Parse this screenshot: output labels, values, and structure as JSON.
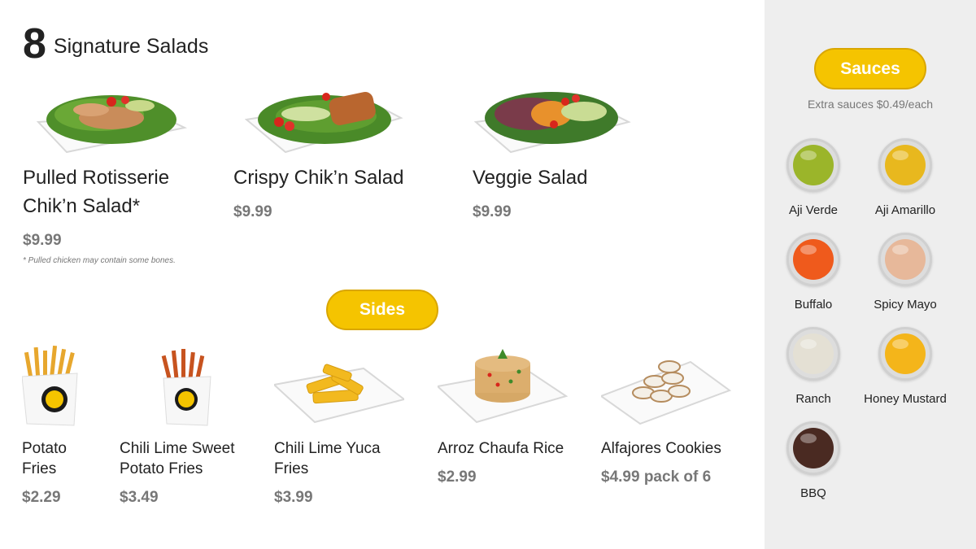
{
  "salads_section": {
    "number": "8",
    "title": "Signature Salads",
    "items": [
      {
        "name_line1": "Pulled Rotisserie",
        "name_line2": "Chik’n Salad*",
        "price": "$9.99",
        "footnote": "* Pulled chicken may contain some bones."
      },
      {
        "name_line1": "Crispy Chik’n Salad",
        "price": "$9.99"
      },
      {
        "name_line1": "Veggie Salad",
        "price": "$9.99"
      }
    ]
  },
  "sides_section": {
    "title": "Sides",
    "items": [
      {
        "name_line1": "Potato",
        "name_line2": "Fries",
        "price": "$2.29"
      },
      {
        "name_line1": "Chili Lime Sweet",
        "name_line2": "Potato Fries",
        "price": "$3.49"
      },
      {
        "name_line1": "Chili Lime Yuca",
        "name_line2": "Fries",
        "price": "$3.99"
      },
      {
        "name_line1": "Arroz Chaufa Rice",
        "price": "$2.99"
      },
      {
        "name_line1": "Alfajores Cookies",
        "price": "$4.99 pack of 6"
      }
    ]
  },
  "sauces_section": {
    "title": "Sauces",
    "note": "Extra sauces $0.49/each",
    "items": [
      {
        "name": "Aji Verde",
        "color": "#9bb52a"
      },
      {
        "name": "Aji Amarillo",
        "color": "#e8b81e"
      },
      {
        "name": "Buffalo",
        "color": "#ef5a1c"
      },
      {
        "name": "Spicy Mayo",
        "color": "#e7b89a"
      },
      {
        "name": "Ranch",
        "color": "#e4e0d4"
      },
      {
        "name": "Honey Mustard",
        "color": "#f4b51a"
      },
      {
        "name": "BBQ",
        "color": "#4a2a22"
      }
    ]
  },
  "colors": {
    "accent": "#f5c400",
    "sidebar_bg": "#eeeeee",
    "price_text": "#777777"
  }
}
